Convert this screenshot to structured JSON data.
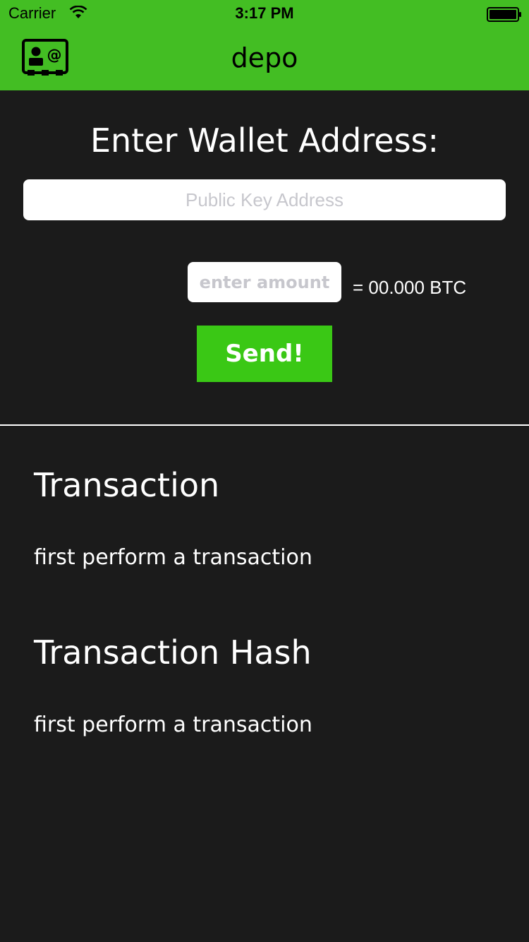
{
  "status_bar": {
    "carrier": "Carrier",
    "time": "3:17 PM",
    "icons": [
      "wifi-icon",
      "battery-icon"
    ]
  },
  "nav": {
    "title": "depo",
    "left_icon": "contact-card-icon",
    "color": "#43be23"
  },
  "form": {
    "heading": "Enter Wallet Address:",
    "address_placeholder": "Public Key Address",
    "amount_placeholder": "enter amount",
    "btc_equivalent": "= 00.000 BTC",
    "send_label": "Send!",
    "send_color": "#3ac815"
  },
  "transaction": {
    "title": "Transaction",
    "value": "first perform a transaction"
  },
  "transaction_hash": {
    "title": "Transaction Hash",
    "value": "first perform a transaction"
  },
  "colors": {
    "background": "#1b1b1b",
    "text": "#ffffff"
  }
}
